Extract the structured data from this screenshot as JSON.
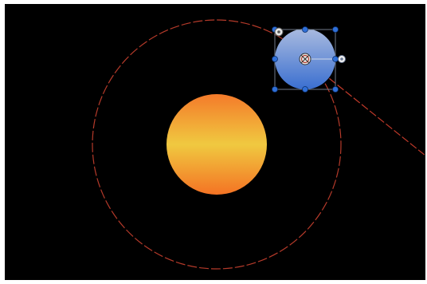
{
  "scene": {
    "background_color": "#000000",
    "sun": {
      "gradient": [
        "#f47a2a",
        "#f3c23b",
        "#f47a2a"
      ]
    },
    "orbit_path": {
      "color": "#b53a2a",
      "style": "dashed"
    },
    "planet": {
      "gradient": [
        "#9ab0dc",
        "#3f76d0"
      ],
      "selected": true
    },
    "selection": {
      "bbox_color": "#6f7a8a",
      "handle_color": "#2f6fd8",
      "anchor_icon": "crosshair-icon",
      "rotation_icon": "rotation-handle-icon",
      "pin_icon": "pin-handle-icon"
    },
    "motion_path": {
      "color": "#c33a2a",
      "style": "dashed"
    }
  }
}
